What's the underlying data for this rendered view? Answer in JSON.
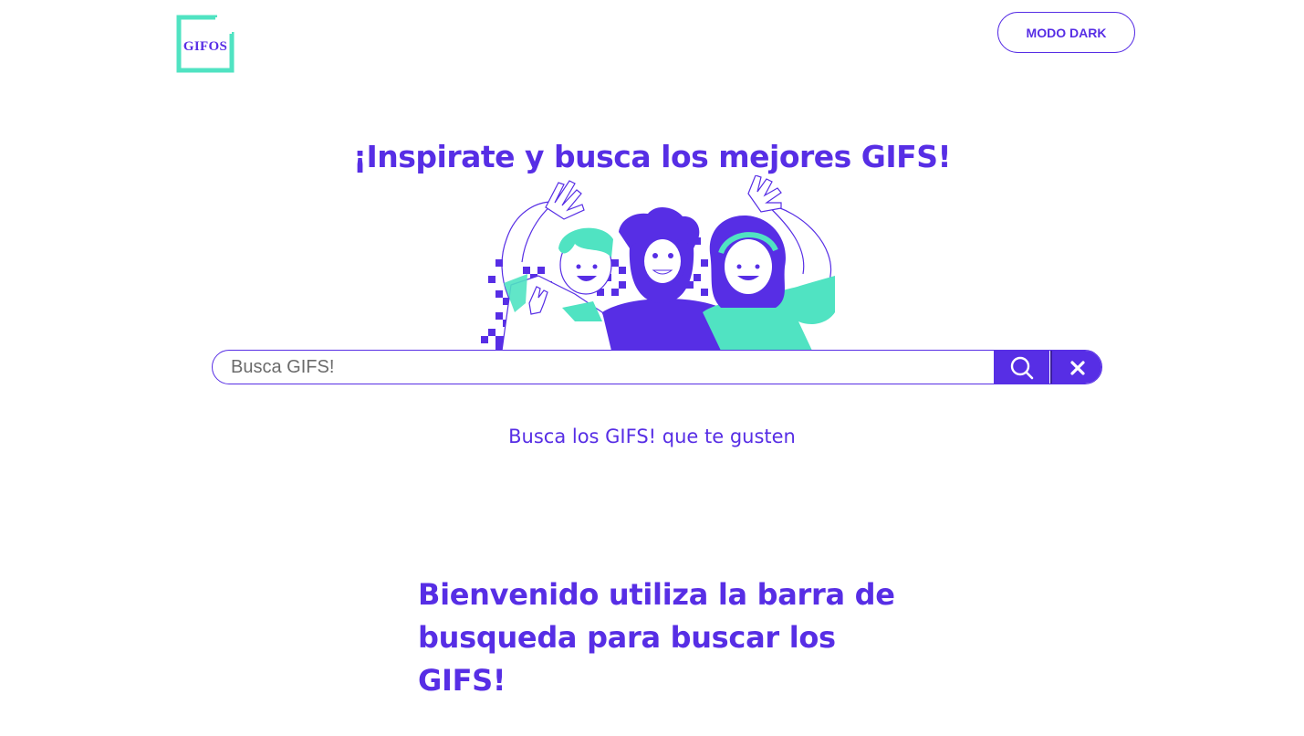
{
  "header": {
    "logo_text": "GIFOS",
    "logo_icon": "document-icon",
    "mode_button_label": "MODO DARK"
  },
  "hero": {
    "title": "¡Inspirate y busca los mejores GIFS!",
    "illustration": "waving-people-illustration"
  },
  "search": {
    "placeholder": "Busca GIFS!",
    "value": "",
    "search_icon": "search-icon",
    "clear_icon": "close-icon"
  },
  "subtitle": "Busca los GIFS! que te gusten",
  "welcome": {
    "line1": "Bienvenido utiliza la barra de",
    "line2": "busqueda para buscar los GIFS!"
  },
  "colors": {
    "accent": "#572EE5",
    "teal": "#50E3C2",
    "background": "#FFFFFF"
  }
}
